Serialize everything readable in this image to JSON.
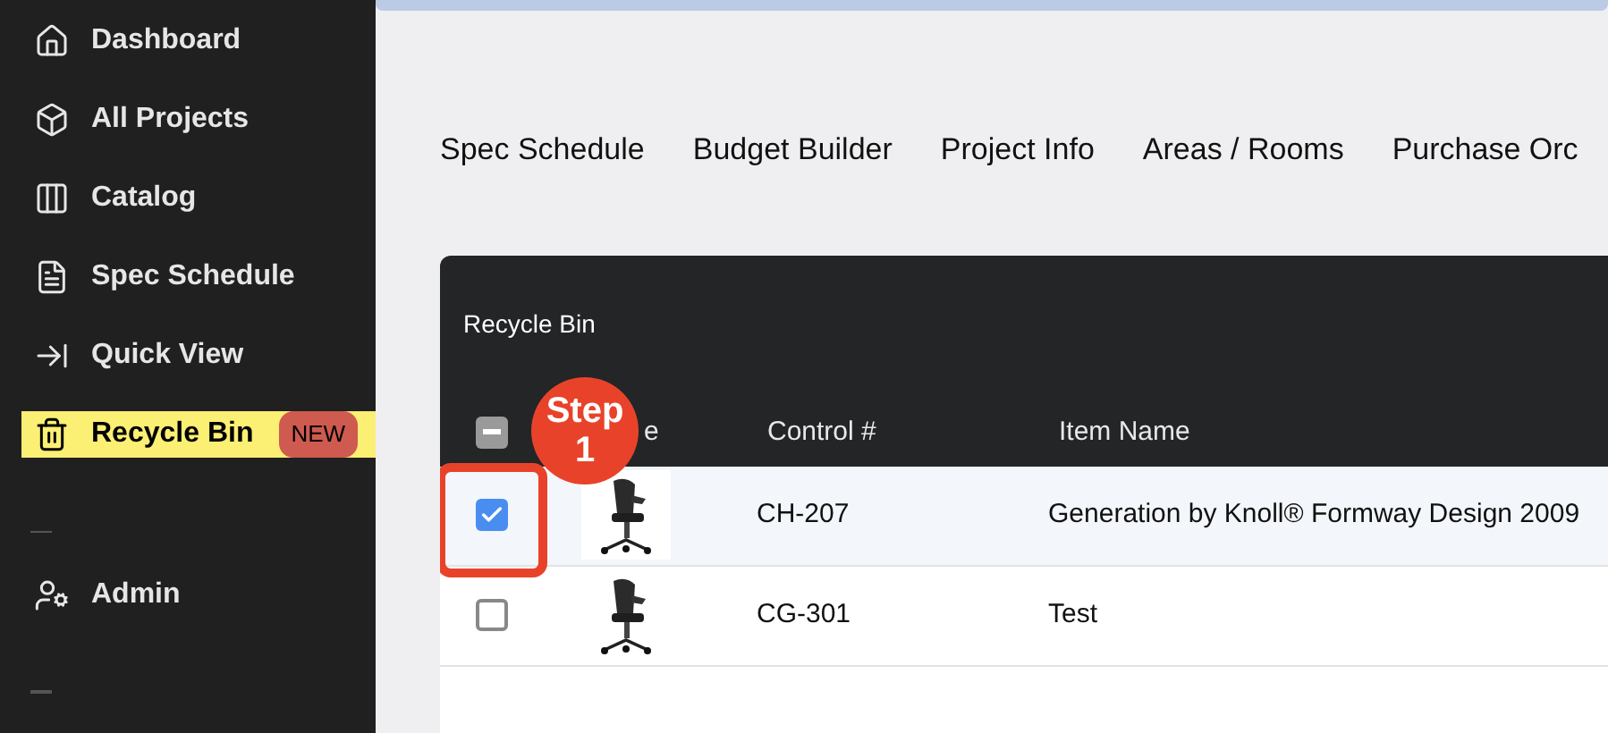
{
  "sidebar": {
    "items": [
      {
        "kind": "link",
        "label": "Dashboard",
        "selected": false
      },
      {
        "kind": "link",
        "label": "All Projects",
        "selected": false
      },
      {
        "kind": "link",
        "label": "Catalog",
        "selected": false
      },
      {
        "kind": "link",
        "label": "Spec Schedule",
        "selected": false
      },
      {
        "kind": "link",
        "label": "Quick View",
        "selected": false
      },
      {
        "kind": "link",
        "label": "Recycle Bin",
        "selected": true,
        "badge": "NEW"
      },
      {
        "kind": "divider"
      },
      {
        "kind": "link",
        "label": "Admin",
        "selected": false
      },
      {
        "kind": "divider"
      }
    ]
  },
  "tabs": [
    {
      "label": "Spec Schedule"
    },
    {
      "label": "Budget Builder"
    },
    {
      "label": "Project Info"
    },
    {
      "label": "Areas / Rooms"
    },
    {
      "label": "Purchase Orc"
    }
  ],
  "table": {
    "title": "Recycle Bin",
    "header_checkbox": {
      "indeterminate": true
    },
    "columns": [
      "e",
      "Control #",
      "Item Name"
    ],
    "rows": [
      {
        "checked": true,
        "control": "CH-207",
        "name": "Generation by Knoll® Formway Design  2009"
      },
      {
        "checked": false,
        "control": "CG-301",
        "name": "Test"
      }
    ]
  },
  "callout": {
    "label": "Step",
    "number": "1"
  }
}
